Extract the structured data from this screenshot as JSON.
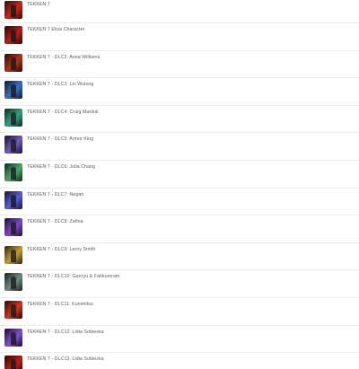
{
  "items": [
    {
      "label": "TEKKEN 7",
      "colors": [
        "#3a0a0a",
        "#c0291e"
      ]
    },
    {
      "label": "TEKKEN 7 Eliza Character",
      "colors": [
        "#2a0606",
        "#b3201a"
      ]
    },
    {
      "label": "TEKKEN 7 - DLC2: Anna Williams",
      "colors": [
        "#2b0a08",
        "#a8361c"
      ]
    },
    {
      "label": "TEKKEN 7 - DLC3: Lei Wulong",
      "colors": [
        "#0d1a33",
        "#3f6fb8"
      ]
    },
    {
      "label": "TEKKEN 7 - DLC4: Craig Marduk",
      "colors": [
        "#0a2a24",
        "#3a9c82"
      ]
    },
    {
      "label": "TEKKEN 7 - DLC5: Armor King",
      "colors": [
        "#1a1030",
        "#6f59b3"
      ]
    },
    {
      "label": "TEKKEN 7 - DLC6: Julia Chang",
      "colors": [
        "#0f2a18",
        "#4ea36a"
      ]
    },
    {
      "label": "TEKKEN 7 - DLC7: Negan",
      "colors": [
        "#141438",
        "#5a5fd0"
      ]
    },
    {
      "label": "TEKKEN 7 - DLC8: Zafina",
      "colors": [
        "#1e0f33",
        "#7d48c4"
      ]
    },
    {
      "label": "TEKKEN 7 - DLC9: Leroy Smith",
      "colors": [
        "#2e2410",
        "#c29b3c"
      ]
    },
    {
      "label": "TEKKEN 7 - DLC10: Ganryu & Fahkumram",
      "colors": [
        "#1c2220",
        "#6f8a80"
      ]
    },
    {
      "label": "TEKKEN 7 - DLC11: Kunimitsu",
      "colors": [
        "#2a0a08",
        "#c53a22"
      ]
    },
    {
      "label": "TEKKEN 7 - DLC12: Lidia Sobieska",
      "colors": [
        "#1a0d30",
        "#8050c8"
      ]
    },
    {
      "label": "TEKKEN 7 - DLC13: Lidia Sobieska",
      "colors": [
        "#2a0606",
        "#b3201a"
      ]
    }
  ]
}
